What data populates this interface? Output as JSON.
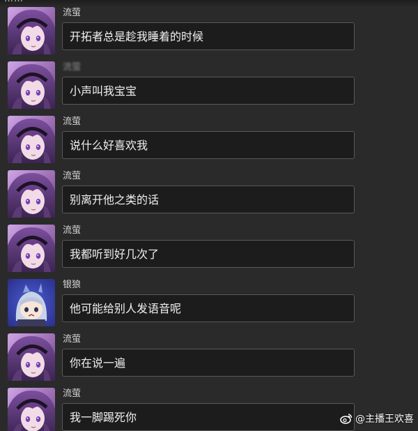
{
  "top_partial_text": "……",
  "messages": [
    {
      "sender": "流萤",
      "avatar": "firefly-avatar",
      "text": "开拓者总是趁我睡着的时候",
      "blurred": false
    },
    {
      "sender": "流萤",
      "avatar": "firefly-avatar",
      "text": "小声叫我宝宝",
      "blurred": true
    },
    {
      "sender": "流萤",
      "avatar": "firefly-avatar",
      "text": "说什么好喜欢我",
      "blurred": false
    },
    {
      "sender": "流萤",
      "avatar": "firefly-avatar",
      "text": "别离开他之类的话",
      "blurred": false
    },
    {
      "sender": "流萤",
      "avatar": "firefly-avatar",
      "text": "我都听到好几次了",
      "blurred": false
    },
    {
      "sender": "银狼",
      "avatar": "silverwolf-avatar",
      "text": "他可能给别人发语音呢",
      "blurred": false
    },
    {
      "sender": "流萤",
      "avatar": "firefly-avatar",
      "text": "你在说一遍",
      "blurred": false
    },
    {
      "sender": "流萤",
      "avatar": "firefly-avatar",
      "text": "我一脚踢死你",
      "blurred": false
    }
  ],
  "watermark": {
    "icon": "weibo-icon",
    "text": "@主播王欢喜"
  },
  "colors": {
    "background": "#2a2a2a",
    "bubble": "#1c1c1c",
    "bubble_border": "#5a5a5a",
    "text": "#f0f0f0"
  }
}
